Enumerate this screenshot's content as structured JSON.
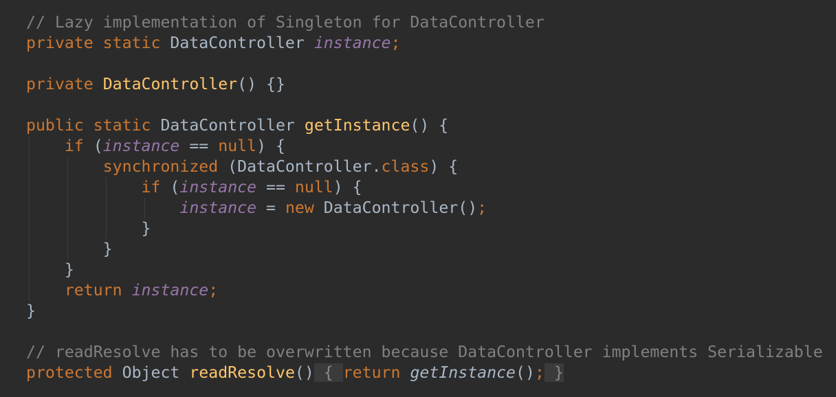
{
  "editor": {
    "theme_colors": {
      "background": "#2b2b2b",
      "keyword": "#cc7832",
      "comment": "#808080",
      "field": "#9876aa",
      "method": "#ffc66d",
      "text": "#a9b7c6"
    },
    "lines": [
      [
        {
          "t": "// Lazy implementation of Singleton for DataController",
          "c": "cm"
        }
      ],
      [
        {
          "t": "private static ",
          "c": "kw"
        },
        {
          "t": "DataController "
        },
        {
          "t": "instance",
          "c": "fld"
        },
        {
          "t": ";",
          "c": "kw"
        }
      ],
      [],
      [
        {
          "t": "private ",
          "c": "kw"
        },
        {
          "t": "DataController",
          "c": "fn"
        },
        {
          "t": "() {}"
        }
      ],
      [],
      [
        {
          "t": "public static ",
          "c": "kw"
        },
        {
          "t": "DataController "
        },
        {
          "t": "getInstance",
          "c": "fn"
        },
        {
          "t": "() {"
        }
      ],
      [
        {
          "t": "    "
        },
        {
          "t": "if ",
          "c": "kw"
        },
        {
          "t": "("
        },
        {
          "t": "instance",
          "c": "fld"
        },
        {
          "t": " == "
        },
        {
          "t": "null",
          "c": "kw"
        },
        {
          "t": ") {"
        }
      ],
      [
        {
          "t": "        "
        },
        {
          "t": "synchronized ",
          "c": "kw"
        },
        {
          "t": "(DataController."
        },
        {
          "t": "class",
          "c": "kw"
        },
        {
          "t": ") {"
        }
      ],
      [
        {
          "t": "            "
        },
        {
          "t": "if ",
          "c": "kw"
        },
        {
          "t": "("
        },
        {
          "t": "instance",
          "c": "fld"
        },
        {
          "t": " == "
        },
        {
          "t": "null",
          "c": "kw"
        },
        {
          "t": ") {"
        }
      ],
      [
        {
          "t": "                "
        },
        {
          "t": "instance",
          "c": "fld"
        },
        {
          "t": " = "
        },
        {
          "t": "new ",
          "c": "kw"
        },
        {
          "t": "DataController()"
        },
        {
          "t": ";",
          "c": "kw"
        }
      ],
      [
        {
          "t": "            }"
        }
      ],
      [
        {
          "t": "        }"
        }
      ],
      [
        {
          "t": "    }"
        }
      ],
      [
        {
          "t": "    "
        },
        {
          "t": "return ",
          "c": "kw"
        },
        {
          "t": "instance",
          "c": "fld"
        },
        {
          "t": ";",
          "c": "kw"
        }
      ],
      [
        {
          "t": "}"
        }
      ],
      [],
      [
        {
          "t": "// readResolve has to be overwritten because DataController implements Serializable",
          "c": "cm"
        }
      ],
      [
        {
          "t": "protected ",
          "c": "kw"
        },
        {
          "t": "Object "
        },
        {
          "t": "readResolve",
          "c": "fn"
        },
        {
          "t": "()"
        },
        {
          "t": " { ",
          "c": "fold"
        },
        {
          "t": "return ",
          "c": "kw"
        },
        {
          "t": "getInstance",
          "c": "it"
        },
        {
          "t": "()"
        },
        {
          "t": ";",
          "c": "kw"
        },
        {
          "t": " }",
          "c": "fold"
        }
      ]
    ]
  }
}
